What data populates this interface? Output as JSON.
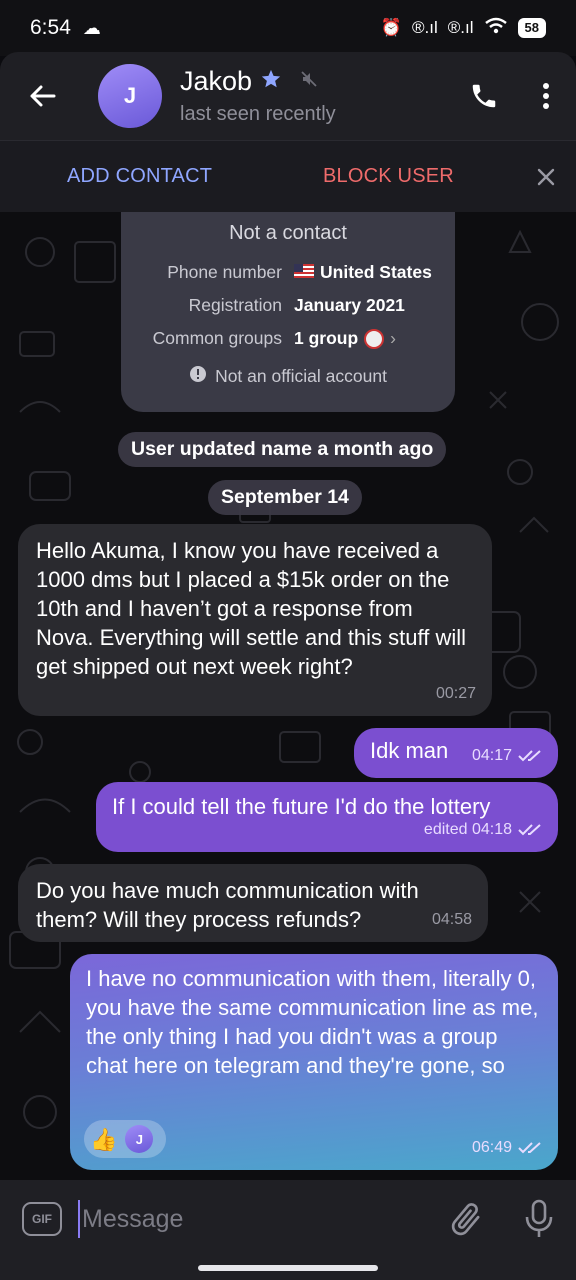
{
  "status_bar": {
    "time": "6:54",
    "battery": "58"
  },
  "header": {
    "avatar_letter": "J",
    "name": "Jakob",
    "subtitle": "last seen recently"
  },
  "action_bar": {
    "add_contact": "ADD CONTACT",
    "block_user": "BLOCK USER"
  },
  "info_card": {
    "title": "Not a contact",
    "rows": [
      {
        "key": "Phone number",
        "value": "United States"
      },
      {
        "key": "Registration",
        "value": "January 2021"
      },
      {
        "key": "Common groups",
        "value": "1 group"
      }
    ],
    "official_note": "Not an official account"
  },
  "service": {
    "name_update": "User updated name a month ago",
    "date": "September 14"
  },
  "messages": [
    {
      "direction": "in",
      "text": "Hello Akuma, I know you have received a 1000 dms but I placed a $15k order on the 10th and I haven’t got a response from Nova. Everything will settle and this stuff will get shipped out next week right?",
      "time": "00:27"
    },
    {
      "direction": "out",
      "text": "Idk man",
      "time": "04:17"
    },
    {
      "direction": "out",
      "text": "If I could tell the future I'd do the lottery",
      "time": "edited 04:18"
    },
    {
      "direction": "in",
      "text": "Do you have much communication with them? Will they process refunds?",
      "time": "04:58"
    },
    {
      "direction": "out",
      "text": "I have no communication with them, literally 0, you have the same communication line as me, the only thing I had you didn't was a group chat here on telegram and they're gone, so",
      "time": "06:49",
      "reaction": "👍",
      "reaction_avatar": "J"
    }
  ],
  "input": {
    "gif_label": "GIF",
    "placeholder": "Message"
  },
  "colors": {
    "accent": "#8a7cf4",
    "add_contact": "#8fa6ff",
    "block_user": "#ef6b6b",
    "outgoing_bubble": "#7b4fd0",
    "incoming_bubble": "#2a2a2f"
  }
}
